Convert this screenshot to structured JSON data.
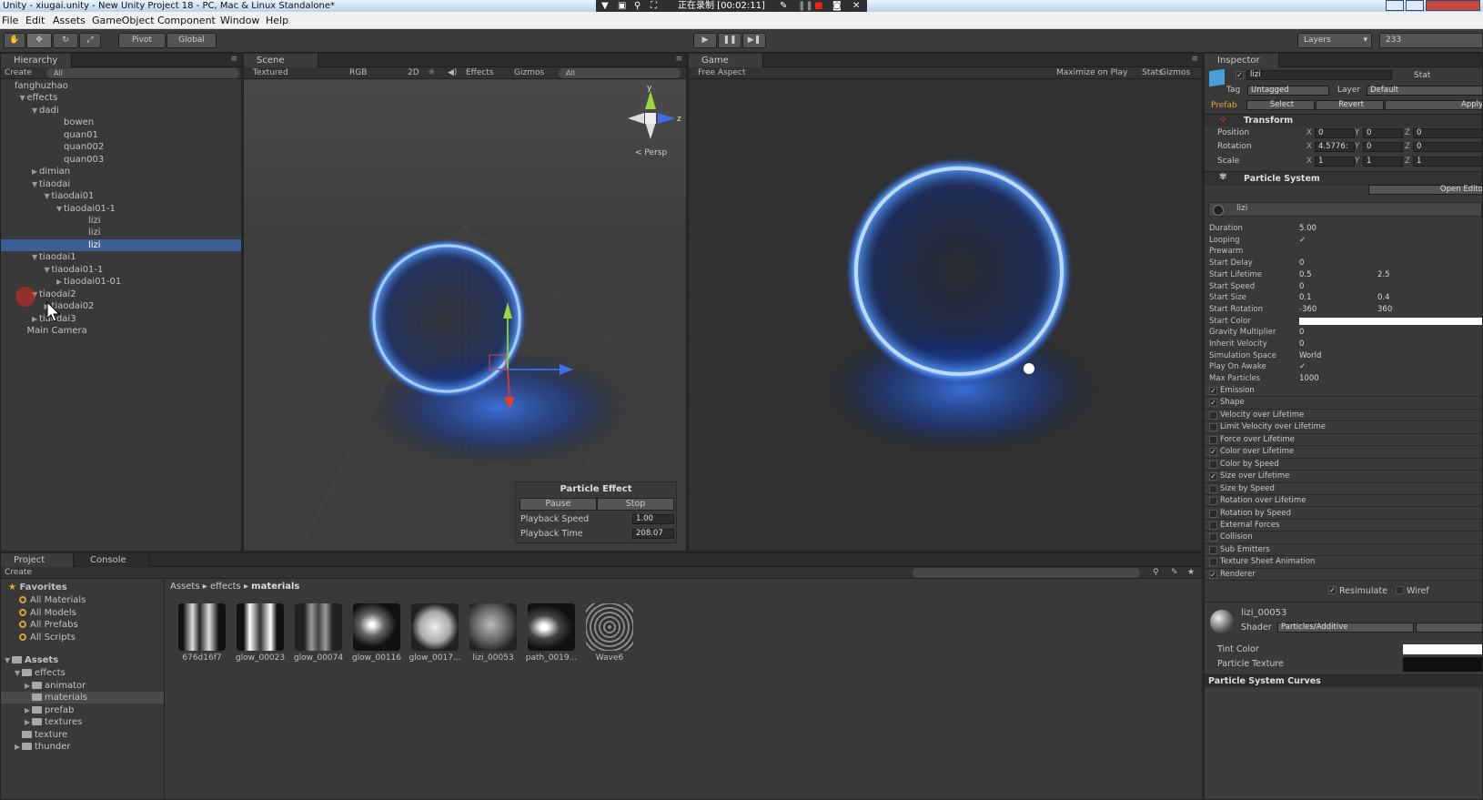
{
  "titlebar": {
    "title": "Unity - xiugai.unity - New Unity Project 18 - PC, Mac & Linux Standalone*"
  },
  "recorder": {
    "status": "正在录制 [00:02:11]"
  },
  "menu": {
    "items": [
      "File",
      "Edit",
      "Assets",
      "GameObject",
      "Component",
      "Window",
      "Help"
    ]
  },
  "toolbar": {
    "pivot": "Pivot",
    "global": "Global",
    "layers": "Layers",
    "layout": "233"
  },
  "hierarchy": {
    "tab": "Hierarchy",
    "create": "Create",
    "search_placeholder": "All",
    "rows": [
      {
        "label": "fanghuzhao",
        "indent": 0,
        "tri": ""
      },
      {
        "label": "effects",
        "indent": 1,
        "tri": "▼"
      },
      {
        "label": "dadi",
        "indent": 2,
        "tri": "▼"
      },
      {
        "label": "bowen",
        "indent": 4,
        "tri": ""
      },
      {
        "label": "quan01",
        "indent": 4,
        "tri": ""
      },
      {
        "label": "quan002",
        "indent": 4,
        "tri": ""
      },
      {
        "label": "quan003",
        "indent": 4,
        "tri": ""
      },
      {
        "label": "dimian",
        "indent": 2,
        "tri": "▶"
      },
      {
        "label": "tiaodai",
        "indent": 2,
        "tri": "▼"
      },
      {
        "label": "tiaodai01",
        "indent": 3,
        "tri": "▼"
      },
      {
        "label": "tiaodai01-1",
        "indent": 4,
        "tri": "▼"
      },
      {
        "label": "lizi",
        "indent": 6,
        "tri": ""
      },
      {
        "label": "lizi",
        "indent": 6,
        "tri": ""
      },
      {
        "label": "lizi",
        "indent": 6,
        "tri": "",
        "selected": true
      },
      {
        "label": "tiaodai1",
        "indent": 2,
        "tri": "▼"
      },
      {
        "label": "tiaodai01-1",
        "indent": 3,
        "tri": "▼"
      },
      {
        "label": "tiaodai01-01",
        "indent": 4,
        "tri": "▶"
      },
      {
        "label": "tiaodai2",
        "indent": 2,
        "tri": "▼"
      },
      {
        "label": "tiaodai02",
        "indent": 3,
        "tri": "▶"
      },
      {
        "label": "tiaodai3",
        "indent": 2,
        "tri": "▶"
      },
      {
        "label": "Main Camera",
        "indent": 1,
        "tri": ""
      }
    ]
  },
  "scene": {
    "tab": "Scene",
    "shading": "Textured",
    "render": "RGB",
    "mode2d": "2D",
    "effects": "Effects",
    "gizmos": "Gizmos",
    "search_placeholder": "All",
    "persp": "Persp",
    "axis_y": "y",
    "axis_z": "z",
    "particle_effect": {
      "title": "Particle Effect",
      "pause": "Pause",
      "stop": "Stop",
      "speed_label": "Playback Speed",
      "speed_value": "1.00",
      "time_label": "Playback Time",
      "time_value": "208.07"
    }
  },
  "game": {
    "tab": "Game",
    "aspect": "Free Aspect",
    "maximize": "Maximize on Play",
    "stats": "Stats",
    "gizmos": "Gizmos"
  },
  "inspector": {
    "tab": "Inspector",
    "object_name": "lizi",
    "static": "Stat",
    "tag_label": "Tag",
    "tag_value": "Untagged",
    "layer_label": "Layer",
    "layer_value": "Default",
    "prefab_label": "Prefab",
    "select": "Select",
    "revert": "Revert",
    "apply": "Apply",
    "transform": {
      "title": "Transform",
      "position": {
        "label": "Position",
        "x": "0",
        "y": "0",
        "z": "0"
      },
      "rotation": {
        "label": "Rotation",
        "x": "4.5776:",
        "y": "0",
        "z": "0"
      },
      "scale": {
        "label": "Scale",
        "x": "1",
        "y": "1",
        "z": "1"
      }
    },
    "particle_system": {
      "title": "Particle System",
      "open_editor": "Open Edito",
      "subname": "lizi",
      "props": [
        {
          "label": "Duration",
          "v1": "5.00",
          "v2": ""
        },
        {
          "label": "Looping",
          "v1": "✓",
          "v2": ""
        },
        {
          "label": "Prewarm",
          "v1": "",
          "v2": ""
        },
        {
          "label": "Start Delay",
          "v1": "0",
          "v2": ""
        },
        {
          "label": "Start Lifetime",
          "v1": "0.5",
          "v2": "2.5"
        },
        {
          "label": "Start Speed",
          "v1": "0",
          "v2": ""
        },
        {
          "label": "Start Size",
          "v1": "0.1",
          "v2": "0.4"
        },
        {
          "label": "Start Rotation",
          "v1": "-360",
          "v2": "360"
        },
        {
          "label": "Start Color",
          "v1": "",
          "v2": ""
        },
        {
          "label": "Gravity Multiplier",
          "v1": "0",
          "v2": ""
        },
        {
          "label": "Inherit Velocity",
          "v1": "0",
          "v2": ""
        },
        {
          "label": "Simulation Space",
          "v1": "World",
          "v2": ""
        },
        {
          "label": "Play On Awake",
          "v1": "✓",
          "v2": ""
        },
        {
          "label": "Max Particles",
          "v1": "1000",
          "v2": ""
        }
      ],
      "modules": [
        {
          "label": "Emission",
          "on": true
        },
        {
          "label": "Shape",
          "on": true
        },
        {
          "label": "Velocity over Lifetime",
          "on": false
        },
        {
          "label": "Limit Velocity over Lifetime",
          "on": false
        },
        {
          "label": "Force over Lifetime",
          "on": false
        },
        {
          "label": "Color over Lifetime",
          "on": true
        },
        {
          "label": "Color by Speed",
          "on": false
        },
        {
          "label": "Size over Lifetime",
          "on": true
        },
        {
          "label": "Size by Speed",
          "on": false
        },
        {
          "label": "Rotation over Lifetime",
          "on": false
        },
        {
          "label": "Rotation by Speed",
          "on": false
        },
        {
          "label": "External Forces",
          "on": false
        },
        {
          "label": "Collision",
          "on": false
        },
        {
          "label": "Sub Emitters",
          "on": false
        },
        {
          "label": "Texture Sheet Animation",
          "on": false
        },
        {
          "label": "Renderer",
          "on": true
        }
      ],
      "resimulate": "Resimulate",
      "wireframe": "Wiref"
    },
    "material": {
      "name": "lizi_00053",
      "shader_label": "Shader",
      "shader_value": "Particles/Additive",
      "tint_color": "Tint Color",
      "particle_texture": "Particle Texture"
    },
    "curves": "Particle System Curves"
  },
  "project": {
    "tab": "Project",
    "console_tab": "Console",
    "create": "Create",
    "favorites_label": "Favorites",
    "favorites": [
      "All Materials",
      "All Models",
      "All Prefabs",
      "All Scripts"
    ],
    "assets_label": "Assets",
    "folders": [
      {
        "label": "effects",
        "indent": 1,
        "tri": "▼"
      },
      {
        "label": "animator",
        "indent": 2,
        "tri": "▶"
      },
      {
        "label": "materials",
        "indent": 2,
        "tri": "",
        "selected": true
      },
      {
        "label": "prefab",
        "indent": 2,
        "tri": "▶"
      },
      {
        "label": "textures",
        "indent": 2,
        "tri": "▶"
      },
      {
        "label": "texture",
        "indent": 1,
        "tri": ""
      },
      {
        "label": "thunder",
        "indent": 1,
        "tri": "▶"
      }
    ],
    "breadcrumb": [
      "Assets",
      "effects",
      "materials"
    ],
    "assets": [
      "676d16f7",
      "glow_00023",
      "glow_00074",
      "glow_00116",
      "glow_0017...",
      "lizi_00053",
      "path_0019...",
      "Wave6"
    ]
  }
}
